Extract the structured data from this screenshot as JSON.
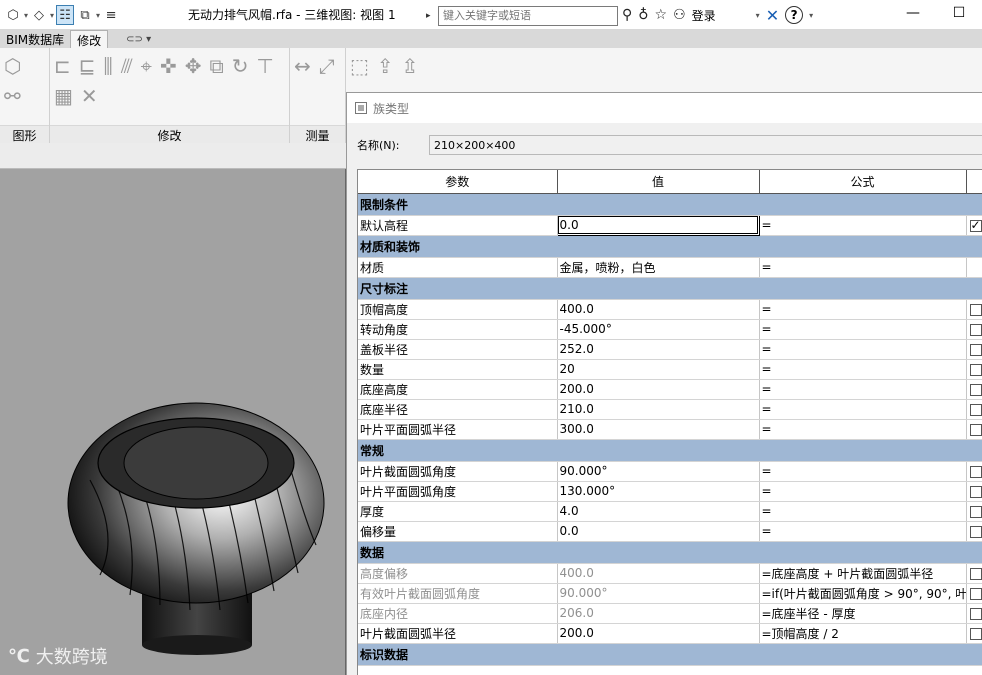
{
  "titlebar": {
    "doc_title": "无动力排气风帽.rfa - 三维视图: 视图 1",
    "search_placeholder": "键入关键字或短语",
    "login_label": "登录",
    "help_label": "?",
    "minimize": "—",
    "maximize": "☐",
    "qat_icons": [
      "app-icon",
      "undo-icon",
      "toggle-icon",
      "sync-icon",
      "customize-icon"
    ]
  },
  "ribbon": {
    "tabs": [
      {
        "label": "BIM数据库"
      },
      {
        "label": "修改",
        "active": true
      }
    ],
    "extra": "⊂⊃ ▾",
    "panels": [
      {
        "label": "图形"
      },
      {
        "label": "修改"
      },
      {
        "label": "测量"
      }
    ]
  },
  "dialog": {
    "title": "族类型",
    "name_label": "名称(N):",
    "name_value": "210×200×400",
    "columns": [
      "参数",
      "值",
      "公式"
    ],
    "rows": [
      {
        "type": "group",
        "label": "限制条件"
      },
      {
        "type": "param",
        "param": "默认高程",
        "value": "0.0",
        "formula": "=",
        "check": true,
        "selected": true
      },
      {
        "type": "group",
        "label": "材质和装饰"
      },
      {
        "type": "param",
        "param": "材质",
        "value": "金属，喷粉，白色",
        "formula": "=",
        "nocheck": true
      },
      {
        "type": "group",
        "label": "尺寸标注"
      },
      {
        "type": "param",
        "param": "顶帽高度",
        "value": "400.0",
        "formula": "="
      },
      {
        "type": "param",
        "param": "转动角度",
        "value": "-45.000°",
        "formula": "="
      },
      {
        "type": "param",
        "param": "盖板半径",
        "value": "252.0",
        "formula": "="
      },
      {
        "type": "param",
        "param": "数量",
        "value": "20",
        "formula": "="
      },
      {
        "type": "param",
        "param": "底座高度",
        "value": "200.0",
        "formula": "="
      },
      {
        "type": "param",
        "param": "底座半径",
        "value": "210.0",
        "formula": "="
      },
      {
        "type": "param",
        "param": "叶片平面圆弧半径",
        "value": "300.0",
        "formula": "="
      },
      {
        "type": "group",
        "label": "常规"
      },
      {
        "type": "param",
        "param": "叶片截面圆弧角度",
        "value": "90.000°",
        "formula": "="
      },
      {
        "type": "param",
        "param": "叶片平面圆弧角度",
        "value": "130.000°",
        "formula": "="
      },
      {
        "type": "param",
        "param": "厚度",
        "value": "4.0",
        "formula": "="
      },
      {
        "type": "param",
        "param": "偏移量",
        "value": "0.0",
        "formula": "="
      },
      {
        "type": "group",
        "label": "数据"
      },
      {
        "type": "param",
        "param": "高度偏移",
        "value": "400.0",
        "formula": "=底座高度 + 叶片截面圆弧半径",
        "dim": true
      },
      {
        "type": "param",
        "param": "有效叶片截面圆弧角度",
        "value": "90.000°",
        "formula": "=if(叶片截面圆弧角度 > 90°, 90°, 叶",
        "dim": true
      },
      {
        "type": "param",
        "param": "底座内径",
        "value": "206.0",
        "formula": "=底座半径 - 厚度",
        "dim": true
      },
      {
        "type": "param",
        "param": "叶片截面圆弧半径",
        "value": "200.0",
        "formula": "=顶帽高度 / 2"
      },
      {
        "type": "group",
        "label": "标识数据"
      }
    ]
  },
  "viewport": {
    "watermark": "大数跨境",
    "watermark_logo": "℃"
  },
  "colors": {
    "group_header": "#9fb7d4",
    "viewport_bg": "#a2a2a2",
    "ribbon_bg": "#f5f5f5"
  }
}
